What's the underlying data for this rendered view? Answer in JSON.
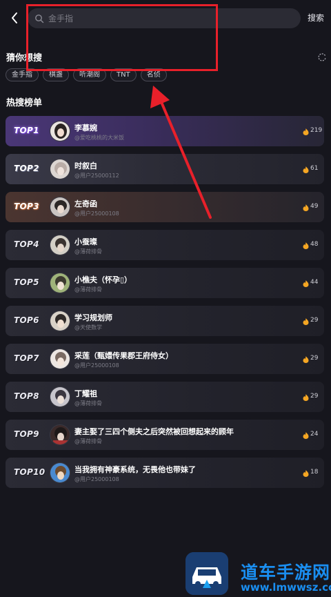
{
  "search": {
    "placeholder": "金手指",
    "submit_label": "搜索"
  },
  "guess": {
    "title": "猜你想搜",
    "chips": [
      "金手指",
      "棋盏",
      "听潮阁",
      "TNT",
      "名侦"
    ]
  },
  "hot": {
    "title": "热搜榜单",
    "items": [
      {
        "rank": "TOP1",
        "name": "李慕婉",
        "user": "@爱吃桃桃的大米饭",
        "count": "219"
      },
      {
        "rank": "TOP2",
        "name": "时叙白",
        "user": "@用户25000112",
        "count": "61"
      },
      {
        "rank": "TOP3",
        "name": "左奇函",
        "user": "@用户25000108",
        "count": "49"
      },
      {
        "rank": "TOP4",
        "name": "小蚕璨",
        "user": "@薄荷排骨",
        "count": "48"
      },
      {
        "rank": "TOP5",
        "name": "小樵夫（怀孕▯）",
        "user": "@薄荷排骨",
        "count": "44"
      },
      {
        "rank": "TOP6",
        "name": "学习规划师",
        "user": "@天使数学",
        "count": "29"
      },
      {
        "rank": "TOP7",
        "name": "采莲（甄嬛传果郡王府侍女）",
        "user": "@用户25000108",
        "count": "29"
      },
      {
        "rank": "TOP8",
        "name": "丁耀祖",
        "user": "@薄荷排骨",
        "count": "29"
      },
      {
        "rank": "TOP9",
        "name": "妻主娶了三四个侧夫之后突然被回想起来的顾年",
        "user": "@薄荷排骨",
        "count": "24"
      },
      {
        "rank": "TOP10",
        "name": "当我拥有神豪系统，无畏他也带妹了",
        "user": "@用户25000108",
        "count": "18"
      }
    ]
  },
  "watermark": {
    "title": "道车手游网",
    "url": "www.lmwwsz.com"
  },
  "colors": {
    "background": "#16161d",
    "annotation_red": "#e8202a",
    "watermark_blue": "#1a8ef0",
    "hot_flame": "#f5a623"
  },
  "icons": {
    "back": "chevron-left-icon",
    "search": "search-icon",
    "refresh": "refresh-icon",
    "hot": "flame-icon"
  }
}
